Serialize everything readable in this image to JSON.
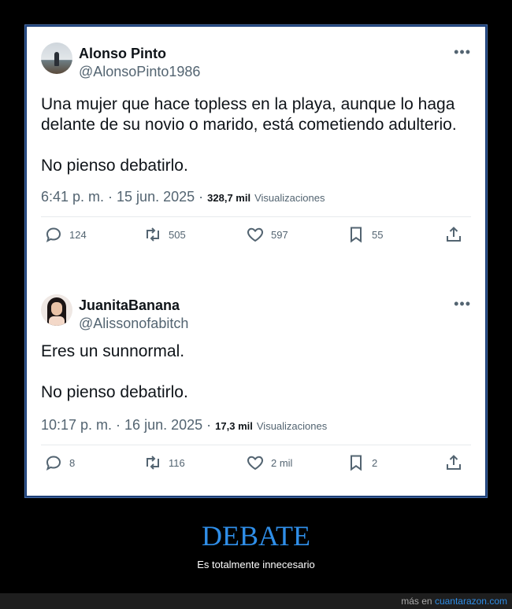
{
  "tweets": [
    {
      "author_name": "Alonso Pinto",
      "handle": "@AlonsoPinto1986",
      "more_label": "•••",
      "paragraphs": [
        "Una mujer que hace topless en la playa, aunque lo haga delante de su novio o marido, está cometiendo adulterio.",
        "No pienso debatirlo."
      ],
      "time": "6:41 p. m. · 15 jun. 2025 ·",
      "views": "328,7 mil",
      "views_label": "Visualizaciones",
      "replies": "124",
      "retweets": "505",
      "likes": "597",
      "bookmarks": "55"
    },
    {
      "author_name": "JuanitaBanana",
      "handle": "@Alissonofabitch",
      "more_label": "•••",
      "paragraphs": [
        "Eres un sunnormal.",
        "No pienso debatirlo."
      ],
      "time": "10:17 p. m. · 16 jun. 2025 ·",
      "views": "17,3 mil",
      "views_label": "Visualizaciones",
      "replies": "8",
      "retweets": "116",
      "likes": "2 mil",
      "bookmarks": "2"
    }
  ],
  "caption": {
    "title": "DEBATE",
    "subtitle": "Es totalmente innecesario"
  },
  "footer": {
    "prefix": "más en",
    "site": "cuantarazon.com"
  },
  "colors": {
    "accent": "#2f8ee8",
    "text_primary": "#0f1419",
    "text_secondary": "#536471"
  },
  "icons": [
    "reply-icon",
    "retweet-icon",
    "like-icon",
    "bookmark-icon",
    "share-icon"
  ]
}
